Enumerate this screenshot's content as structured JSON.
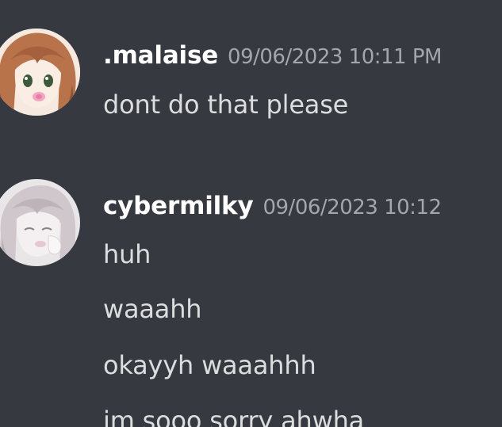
{
  "messages": [
    {
      "username": ".malaise",
      "timestamp": "09/06/2023 10:11 PM",
      "avatar_icon": "anime-avatar-brown-hair",
      "lines": [
        "dont do that please"
      ]
    },
    {
      "username": "cybermilky",
      "timestamp": "09/06/2023 10:12",
      "avatar_icon": "anime-avatar-pale",
      "lines": [
        "huh",
        "waaahh",
        "okayyh waaahhh",
        "im sooo sorry ahwha"
      ]
    }
  ],
  "colors": {
    "background": "#36393f",
    "username": "#ffffff",
    "timestamp": "#a3a6aa",
    "message_text": "#dcddde"
  }
}
